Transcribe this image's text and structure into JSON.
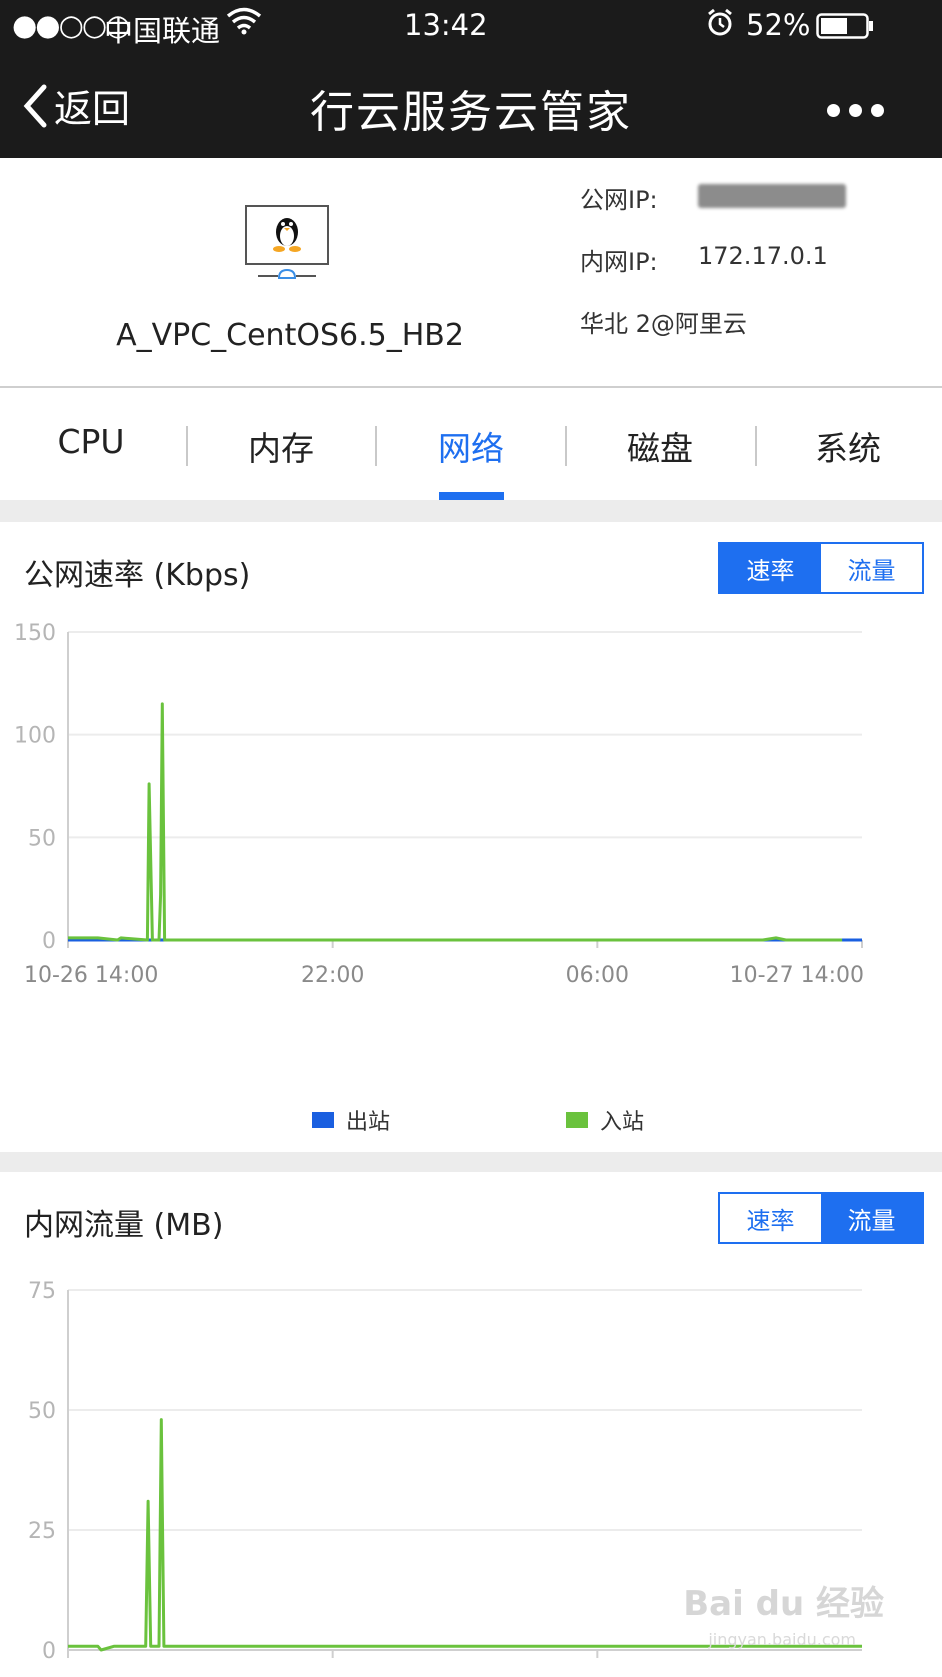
{
  "status_bar": {
    "signal": "●●○○○",
    "carrier": "中国联通",
    "time": "13:42",
    "battery": "52%"
  },
  "nav": {
    "back_label": "返回",
    "title": "行云服务云管家"
  },
  "server": {
    "name": "A_VPC_CentOS6.5_HB2",
    "public_ip_label": "公网IP:",
    "private_ip_label": "内网IP:",
    "private_ip": "172.17.0.1",
    "region": "华北 2@阿里云"
  },
  "tabs": [
    {
      "label": "CPU",
      "active": false
    },
    {
      "label": "内存",
      "active": false
    },
    {
      "label": "网络",
      "active": true
    },
    {
      "label": "磁盘",
      "active": false
    },
    {
      "label": "系统",
      "active": false
    }
  ],
  "colors": {
    "accent": "#1e6ff0",
    "outbound": "#1a5fe0",
    "inbound": "#6ac23d",
    "nav_bg": "#1b1b1b"
  },
  "sections": [
    {
      "title": "公网速率 (Kbps)",
      "toggle": {
        "left": "速率",
        "right": "流量",
        "active": "left"
      }
    },
    {
      "title": "内网流量 (MB)",
      "toggle": {
        "left": "速率",
        "right": "流量",
        "active": "right"
      }
    }
  ],
  "watermark": {
    "main": "Bai du 经验",
    "sub": "jingyan.baidu.com"
  },
  "chart_data": [
    {
      "type": "line",
      "title": "公网速率 (Kbps)",
      "ylim": [
        0,
        150
      ],
      "yticks": [
        0,
        50,
        100,
        150
      ],
      "xlim": [
        0,
        24
      ],
      "xticks": [
        {
          "v": 0,
          "label": "10-26 14:00"
        },
        {
          "v": 8,
          "label": "22:00"
        },
        {
          "v": 16,
          "label": "06:00"
        },
        {
          "v": 24,
          "label": "10-27 14:00"
        }
      ],
      "grid": true,
      "legend": "bottom",
      "series": [
        {
          "name": "出站",
          "color": "#1a5fe0",
          "points": [
            [
              0,
              0
            ],
            [
              24,
              0
            ]
          ]
        },
        {
          "name": "入站",
          "color": "#6ac23d",
          "points": [
            [
              0,
              1
            ],
            [
              0.9,
              1
            ],
            [
              1.5,
              0
            ],
            [
              1.6,
              1
            ],
            [
              2.4,
              0
            ],
            [
              2.45,
              76
            ],
            [
              2.55,
              0
            ],
            [
              2.75,
              0
            ],
            [
              2.8,
              22
            ],
            [
              2.85,
              115
            ],
            [
              2.92,
              0
            ],
            [
              3.5,
              0
            ],
            [
              6,
              0
            ],
            [
              14,
              0
            ],
            [
              21,
              0
            ],
            [
              21.4,
              1
            ],
            [
              21.7,
              0
            ],
            [
              23.4,
              0
            ]
          ]
        }
      ]
    },
    {
      "type": "line",
      "title": "内网流量 (MB)",
      "ylim": [
        0,
        75
      ],
      "yticks": [
        0,
        25,
        50,
        75
      ],
      "xlim": [
        0,
        24
      ],
      "xticks": [],
      "grid": true,
      "series": [
        {
          "name": "入站",
          "color": "#6ac23d",
          "points": [
            [
              0,
              0.8
            ],
            [
              0.9,
              0.8
            ],
            [
              1.0,
              0
            ],
            [
              1.4,
              0.8
            ],
            [
              2.35,
              0.8
            ],
            [
              2.42,
              31
            ],
            [
              2.5,
              0.8
            ],
            [
              2.75,
              0.8
            ],
            [
              2.82,
              48
            ],
            [
              2.9,
              0.8
            ],
            [
              24,
              0.8
            ]
          ]
        }
      ]
    }
  ]
}
